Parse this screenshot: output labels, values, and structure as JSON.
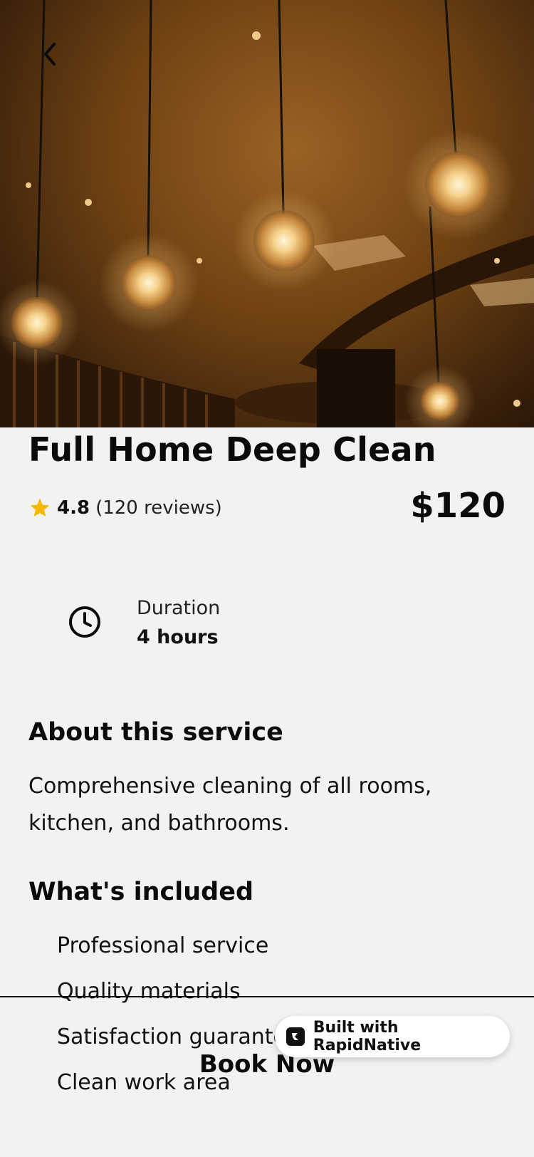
{
  "service": {
    "title": "Full Home Deep Clean",
    "rating": "4.8",
    "reviews": "(120 reviews)",
    "price": "$120"
  },
  "duration": {
    "label": "Duration",
    "value": "4 hours",
    "icon": "clock-icon"
  },
  "about": {
    "heading": "About this service",
    "text": "Comprehensive cleaning of all rooms, kitchen, and bathrooms."
  },
  "included": {
    "heading": "What's included",
    "items": [
      "Professional service",
      "Quality materials",
      "Satisfaction guarantee",
      "Clean work area"
    ]
  },
  "actions": {
    "book_label": "Book Now",
    "back_icon": "chevron-left-icon"
  },
  "badge": {
    "label": "Built with RapidNative"
  },
  "colors": {
    "background": "#f2f2f2",
    "star": "#f5b800",
    "text": "#111111"
  }
}
